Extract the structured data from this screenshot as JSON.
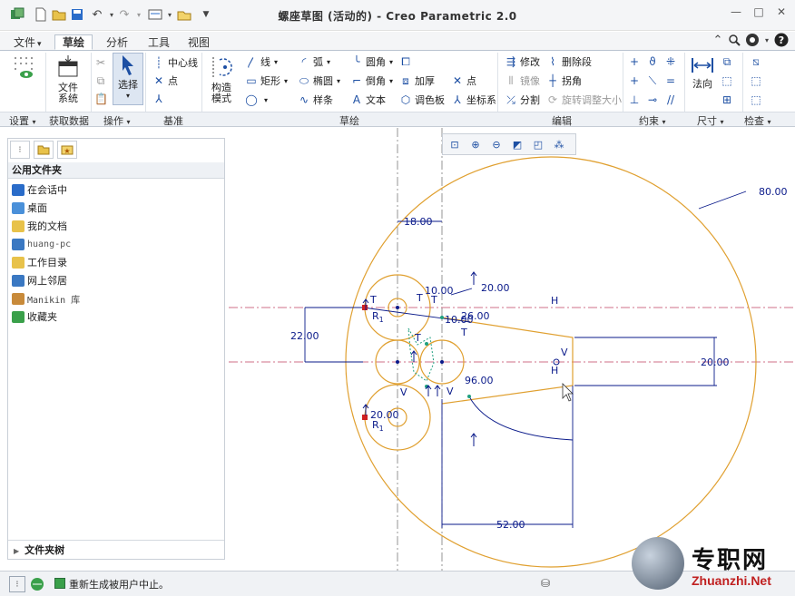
{
  "window": {
    "title": "螺座草图 (活动的) - Creo Parametric 2.0",
    "controls": {
      "minimize": "—",
      "restore": "□",
      "close": "✕"
    }
  },
  "tabs": [
    {
      "label": "文件",
      "arrow": "▾"
    },
    {
      "label": "草绘"
    },
    {
      "label": "分析"
    },
    {
      "label": "工具"
    },
    {
      "label": "视图"
    }
  ],
  "ribbon": {
    "file_system": "文件\n系统",
    "select": "选择",
    "construction_mode": "构造\n模式",
    "centerline": "中心线",
    "point": "点",
    "line": "线",
    "arc": "弧",
    "fillet": "圆角",
    "rectangle": "矩形",
    "ellipse": "椭圆",
    "chamfer": "倒角",
    "thicken": "加厚",
    "point2": "点",
    "spline": "样条",
    "text": "文本",
    "palette": "调色板",
    "coordinate_system": "坐标系",
    "modify": "修改",
    "delete_segment": "删除段",
    "mirror": "镜像",
    "corner": "拐角",
    "divide": "分割",
    "rotate_resize": "旋转调整大小",
    "normal": "法向"
  },
  "groups": [
    {
      "label": "设置",
      "arrow": "▾"
    },
    {
      "label": "获取数据"
    },
    {
      "label": "操作",
      "arrow": "▾"
    },
    {
      "label": "基准"
    },
    {
      "label": "草绘"
    },
    {
      "label": "编辑"
    },
    {
      "label": "约束",
      "arrow": "▾"
    },
    {
      "label": "尺寸",
      "arrow": "▾"
    },
    {
      "label": "检查",
      "arrow": "▾"
    }
  ],
  "sidebar": {
    "header": "公用文件夹",
    "items": [
      {
        "label": "在会话中",
        "color": "#2a6cc9"
      },
      {
        "label": "桌面",
        "color": "#4a90d9"
      },
      {
        "label": "我的文档",
        "color": "#e8c24a"
      },
      {
        "label": "huang-pc",
        "color": "#3a78c2"
      },
      {
        "label": "工作目录",
        "color": "#e8c24a"
      },
      {
        "label": "网上邻居",
        "color": "#3a78c2"
      },
      {
        "label": "Manikin 库",
        "color": "#c88a3a"
      },
      {
        "label": "收藏夹",
        "color": "#3aa04a"
      }
    ],
    "footer": "文件夹树"
  },
  "sketch": {
    "dims": {
      "d80": "80.00",
      "d18": "18.00",
      "d10a": "10.00",
      "d20a": "20.00",
      "d26": "26.00",
      "d10b": "10.00",
      "d22": "22.00",
      "d20b": "20.00",
      "d96": "96.00",
      "d20c": "20.00",
      "d52": "52.00"
    },
    "constraints": {
      "H1": "H",
      "H2": "H",
      "V1": "V",
      "V2": "V",
      "V3": "V",
      "T1": "T",
      "T2": "T",
      "T3": "T",
      "T4": "T",
      "T5": "T",
      "R1": "R",
      "R1sub": "1",
      "R2": "R",
      "R2sub": "1"
    },
    "sketch_color": "#e0a030",
    "dim_color": "#0a1a8a"
  },
  "status": {
    "message": "重新生成被用户中止。"
  },
  "watermark": {
    "cn": "专职网",
    "en": "Zhuanzhi.Net"
  }
}
